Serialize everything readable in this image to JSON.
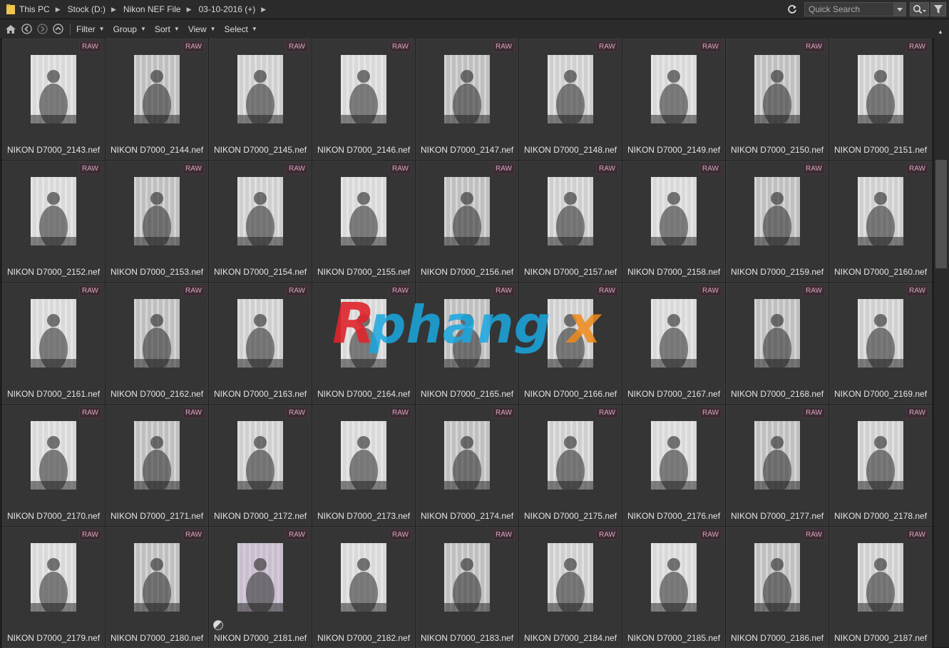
{
  "address_bar": {
    "breadcrumbs": [
      "This PC",
      "Stock (D:)",
      "Nikon NEF File",
      "03-10-2016 (+)"
    ],
    "search_placeholder": "Quick Search"
  },
  "toolbar": {
    "menus": [
      "Filter",
      "Group",
      "Sort",
      "View",
      "Select"
    ]
  },
  "badge_label": "RAW",
  "files": [
    "NIKON D7000_2143.nef",
    "NIKON D7000_2144.nef",
    "NIKON D7000_2145.nef",
    "NIKON D7000_2146.nef",
    "NIKON D7000_2147.nef",
    "NIKON D7000_2148.nef",
    "NIKON D7000_2149.nef",
    "NIKON D7000_2150.nef",
    "NIKON D7000_2151.nef",
    "NIKON D7000_2152.nef",
    "NIKON D7000_2153.nef",
    "NIKON D7000_2154.nef",
    "NIKON D7000_2155.nef",
    "NIKON D7000_2156.nef",
    "NIKON D7000_2157.nef",
    "NIKON D7000_2158.nef",
    "NIKON D7000_2159.nef",
    "NIKON D7000_2160.nef",
    "NIKON D7000_2161.nef",
    "NIKON D7000_2162.nef",
    "NIKON D7000_2163.nef",
    "NIKON D7000_2164.nef",
    "NIKON D7000_2165.nef",
    "NIKON D7000_2166.nef",
    "NIKON D7000_2167.nef",
    "NIKON D7000_2168.nef",
    "NIKON D7000_2169.nef",
    "NIKON D7000_2170.nef",
    "NIKON D7000_2171.nef",
    "NIKON D7000_2172.nef",
    "NIKON D7000_2173.nef",
    "NIKON D7000_2174.nef",
    "NIKON D7000_2175.nef",
    "NIKON D7000_2176.nef",
    "NIKON D7000_2177.nef",
    "NIKON D7000_2178.nef",
    "NIKON D7000_2179.nef",
    "NIKON D7000_2180.nef",
    "NIKON D7000_2181.nef",
    "NIKON D7000_2182.nef",
    "NIKON D7000_2183.nef",
    "NIKON D7000_2184.nef",
    "NIKON D7000_2185.nef",
    "NIKON D7000_2186.nef",
    "NIKON D7000_2187.nef"
  ],
  "edited_file": "NIKON D7000_2181.nef",
  "watermark_text": "Rphangx",
  "colors": {
    "background": "#1e1e1e",
    "cell": "#353535",
    "raw_badge_text": "#d9a6bf",
    "watermark_red": "#e0242c",
    "watermark_blue": "#1aa7e0"
  },
  "icons": [
    "folder-icon",
    "refresh-icon",
    "search-icon",
    "filter-icon",
    "home-icon",
    "back-icon",
    "forward-icon",
    "up-icon"
  ]
}
